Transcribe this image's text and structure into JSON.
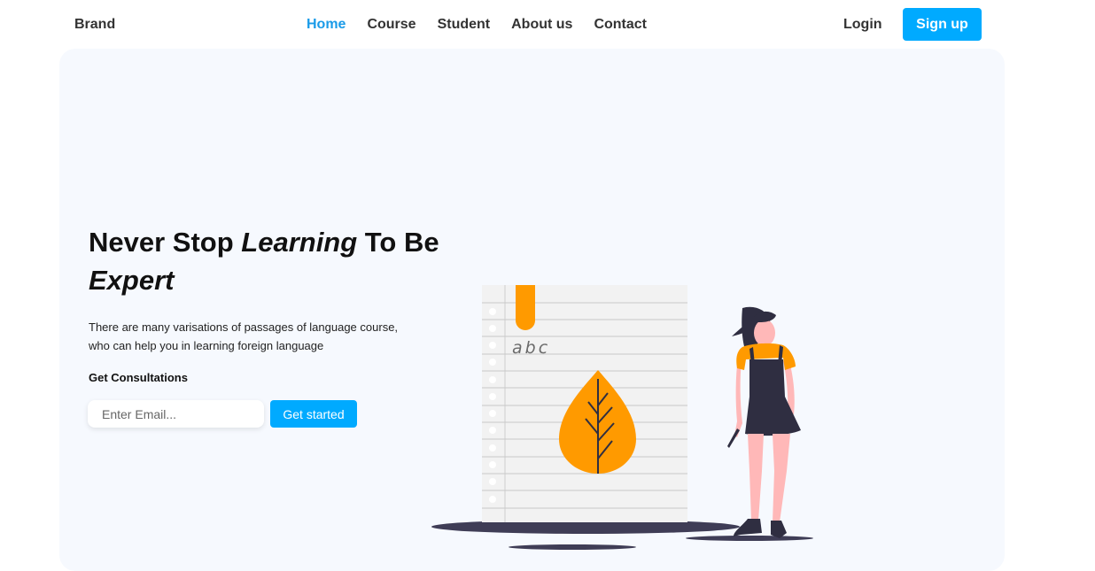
{
  "navbar": {
    "brand": "Brand",
    "links": [
      {
        "label": "Home",
        "active": true
      },
      {
        "label": "Course",
        "active": false
      },
      {
        "label": "Student",
        "active": false
      },
      {
        "label": "About us",
        "active": false
      },
      {
        "label": "Contact",
        "active": false
      }
    ],
    "login": "Login",
    "signup": "Sign up"
  },
  "hero": {
    "headline_part1": "Never Stop ",
    "headline_em1": "Learning",
    "headline_part2": " To Be ",
    "headline_em2": "Expert",
    "description": "There are many varisations of passages of language course, who can help you in learning foreign language",
    "consult_label": "Get Consultations",
    "email_placeholder": "Enter Email...",
    "cta": "Get started",
    "notebook_text": "abc"
  },
  "colors": {
    "accent": "#00aaff",
    "active_link": "#1a9be8",
    "hero_bg": "#f6f9fe",
    "illustration_orange": "#ff9a00",
    "illustration_dark": "#2f2e41",
    "skin": "#ffb8b8"
  }
}
